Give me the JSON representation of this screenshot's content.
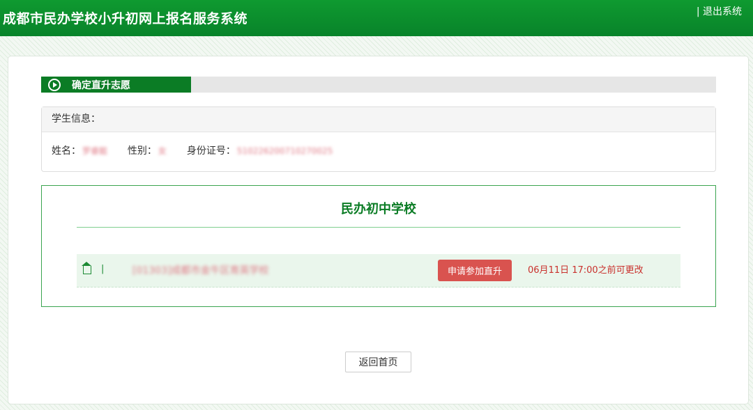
{
  "header": {
    "title": "成都市民办学校小升初网上报名服务系统",
    "logout_label": "| 退出系统"
  },
  "section": {
    "title": "确定直升志愿"
  },
  "student_info": {
    "heading": "学生信息：",
    "name_label": "姓名：",
    "name_value": "罗睿懿",
    "gender_label": "性别：",
    "gender_value": "女",
    "id_label": "身份证号：",
    "id_value": "510226200710270025"
  },
  "school_section": {
    "title": "民办初中学校",
    "row": {
      "separator": "|",
      "school_name": "[01303]成都市金牛区育英学校",
      "apply_button": "申请参加直升",
      "deadline": "06月11日 17:00之前可更改"
    }
  },
  "footer": {
    "back_button": "返回首页"
  },
  "colors": {
    "brand_green": "#0b7c25",
    "header_green": "#0b8a2a",
    "apply_red": "#d9534f",
    "deadline_red": "#c9302c"
  }
}
